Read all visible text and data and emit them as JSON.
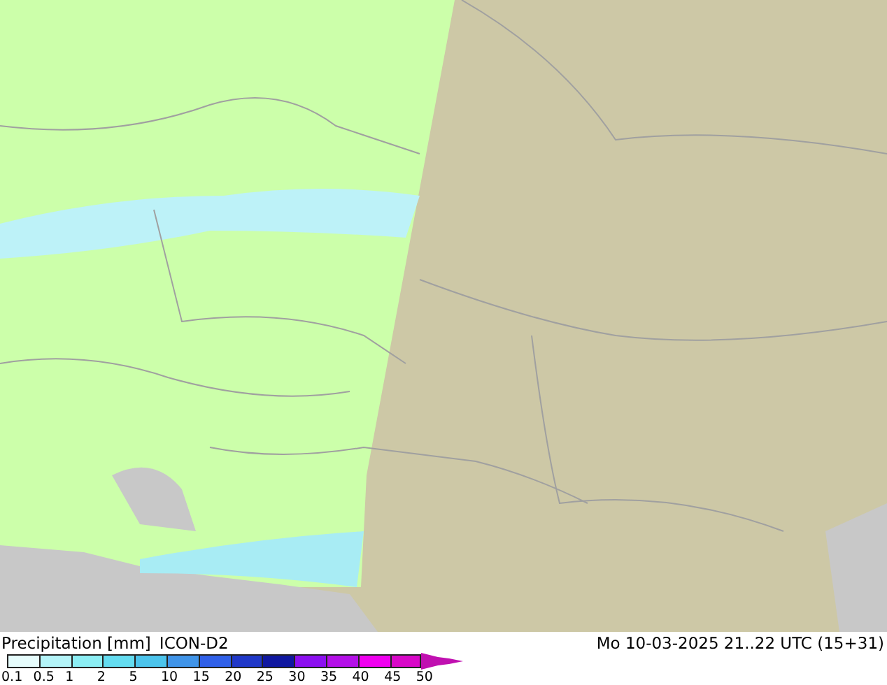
{
  "title": "Precipitation [mm]",
  "model": "ICON-D2",
  "valid_time": "Mo 10-03-2025 21..22 UTC (15+31)",
  "legend": [
    {
      "label": "0.1",
      "color": "#e6fcfc"
    },
    {
      "label": "0.5",
      "color": "#b4f4f8"
    },
    {
      "label": "1",
      "color": "#8ceef4"
    },
    {
      "label": "2",
      "color": "#64dcf0"
    },
    {
      "label": "5",
      "color": "#4cc4ec"
    },
    {
      "label": "10",
      "color": "#4094e8"
    },
    {
      "label": "15",
      "color": "#3060e8"
    },
    {
      "label": "20",
      "color": "#2038c8"
    },
    {
      "label": "25",
      "color": "#1018a0"
    },
    {
      "label": "30",
      "color": "#8c10f0"
    },
    {
      "label": "35",
      "color": "#b410e8"
    },
    {
      "label": "40",
      "color": "#f000f0"
    },
    {
      "label": "45",
      "color": "#d808c8"
    },
    {
      "label": "50",
      "color": "#c010b0"
    }
  ]
}
